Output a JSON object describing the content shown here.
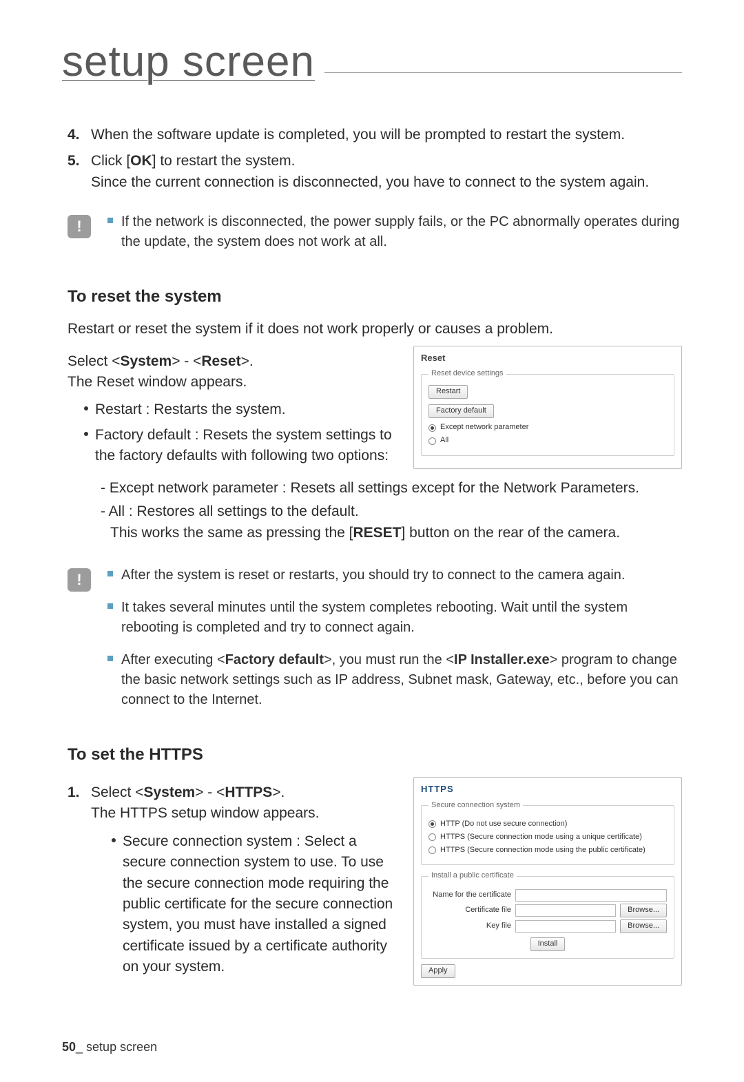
{
  "header": {
    "title": "setup screen"
  },
  "steps": {
    "s4": {
      "num": "4.",
      "text": "When the software update is completed, you will be prompted to restart the system."
    },
    "s5": {
      "num": "5.",
      "line1_pre": "Click [",
      "line1_bold": "OK",
      "line1_post": "] to restart the system.",
      "line2": "Since the current connection is disconnected, you have to connect to the system again."
    }
  },
  "caution1": {
    "item1": "If the network is disconnected, the power supply fails, or the PC abnormally operates during the update, the system does not work at all."
  },
  "reset": {
    "heading": "To reset the system",
    "intro": "Restart or reset the system if it does not work properly or causes a problem.",
    "select_pre": "Select <",
    "select_b1": "System",
    "select_mid": "> - <",
    "select_b2": "Reset",
    "select_post": ">.",
    "select_line2": "The Reset window appears.",
    "bullets": {
      "b1": "Restart : Restarts the system.",
      "b2": "Factory default : Resets the system settings to the factory defaults with following two options:"
    },
    "dashes": {
      "d1": "- Except network parameter : Resets all settings except for the Network Parameters.",
      "d2_l1": "- All : Restores all settings to the default.",
      "d2_l2_pre": "This works the same as pressing the [",
      "d2_l2_bold": "RESET",
      "d2_l2_post": "] button on the rear of the camera."
    },
    "ui": {
      "title": "Reset",
      "legend1": "Reset device settings",
      "restart_btn": "Restart",
      "factory_btn": "Factory default",
      "opt1": "Except network parameter",
      "opt2": "All"
    }
  },
  "caution2": {
    "item1": "After the system is reset or restarts, you should try to connect to the camera again.",
    "item2": "It takes several minutes until the system completes rebooting. Wait until the system rebooting is completed and try to connect again.",
    "item3_pre": "After executing <",
    "item3_b1": "Factory default",
    "item3_mid": ">, you must run the <",
    "item3_b2": "IP Installer.exe",
    "item3_post": "> program to change the basic network settings such as IP address, Subnet mask, Gateway, etc., before you can connect to the Internet."
  },
  "https": {
    "heading": "To set the HTTPS",
    "s1": {
      "num": "1.",
      "line1_pre": "Select <",
      "line1_b1": "System",
      "line1_mid": "> - <",
      "line1_b2": "HTTPS",
      "line1_post": ">.",
      "line2": "The HTTPS setup window appears."
    },
    "bullet1": "Secure connection system : Select a secure connection system to use. To use the secure connection mode requiring the public certificate for the secure connection system, you must have installed a signed certificate issued by a certificate authority on your system.",
    "ui": {
      "title": "HTTPS",
      "legend1": "Secure connection system",
      "opt1": "HTTP   (Do not use secure connection)",
      "opt2": "HTTPS (Secure connection mode using a unique certificate)",
      "opt3": "HTTPS (Secure connection mode using the public certificate)",
      "legend2": "Install a public certificate",
      "lbl_name": "Name for the certificate",
      "lbl_cert": "Certificate file",
      "lbl_key": "Key file",
      "browse": "Browse...",
      "install": "Install",
      "apply": "Apply"
    }
  },
  "footer": {
    "pagenum": "50",
    "sep": "_ ",
    "label": "setup screen"
  }
}
